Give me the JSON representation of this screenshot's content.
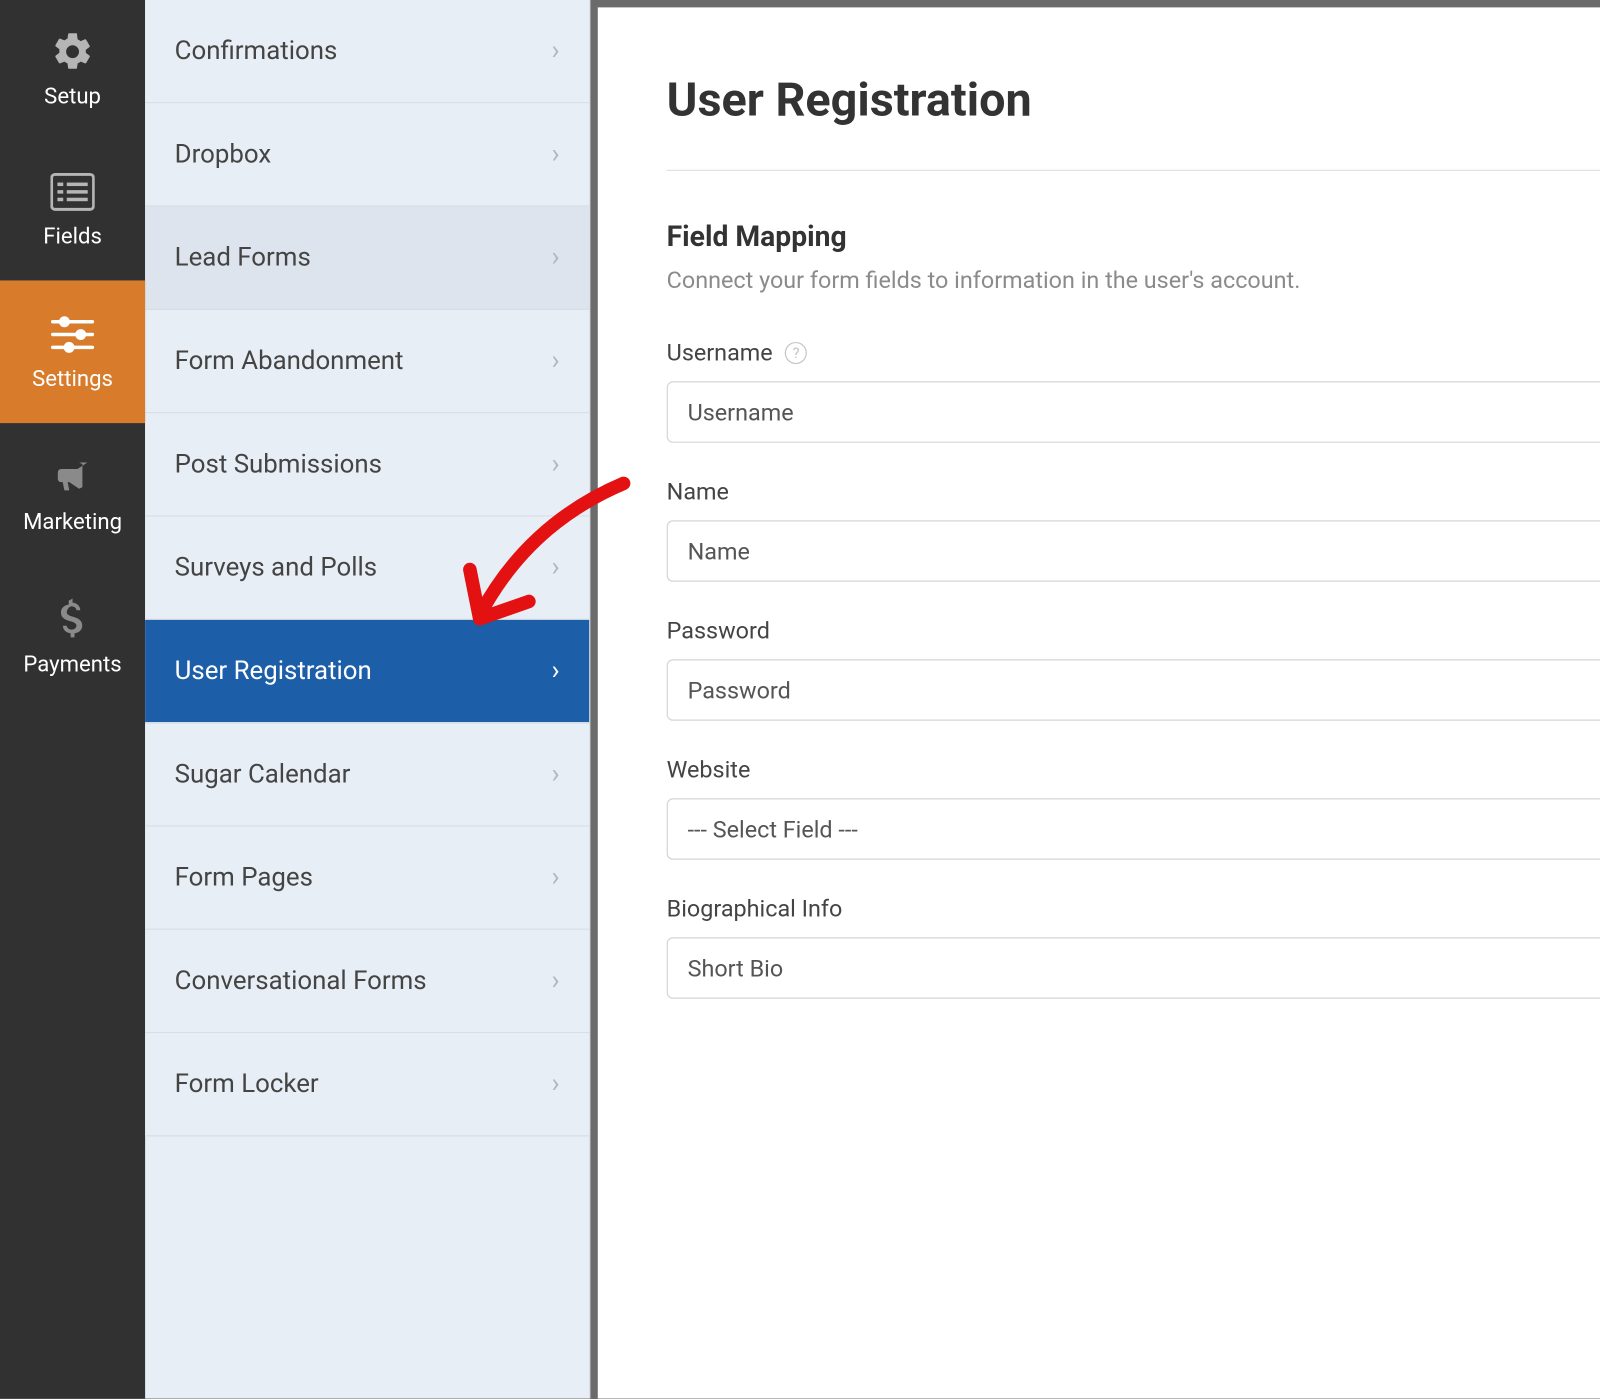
{
  "iconbar": {
    "items": [
      {
        "label": "Setup"
      },
      {
        "label": "Fields"
      },
      {
        "label": "Settings"
      },
      {
        "label": "Marketing"
      },
      {
        "label": "Payments"
      }
    ]
  },
  "settings_menu": {
    "items": [
      {
        "label": "Confirmations"
      },
      {
        "label": "Dropbox"
      },
      {
        "label": "Lead Forms"
      },
      {
        "label": "Form Abandonment"
      },
      {
        "label": "Post Submissions"
      },
      {
        "label": "Surveys and Polls"
      },
      {
        "label": "User Registration"
      },
      {
        "label": "Sugar Calendar"
      },
      {
        "label": "Form Pages"
      },
      {
        "label": "Conversational Forms"
      },
      {
        "label": "Form Locker"
      }
    ]
  },
  "content": {
    "title": "User Registration",
    "section_title": "Field Mapping",
    "section_desc": "Connect your form fields to information in the user's account.",
    "fields": [
      {
        "label": "Username",
        "value": "Username",
        "help": true
      },
      {
        "label": "Name",
        "value": "Name",
        "help": false
      },
      {
        "label": "Password",
        "value": "Password",
        "help": false
      },
      {
        "label": "Website",
        "value": "--- Select Field ---",
        "help": false
      },
      {
        "label": "Biographical Info",
        "value": "Short Bio",
        "help": false
      }
    ]
  }
}
